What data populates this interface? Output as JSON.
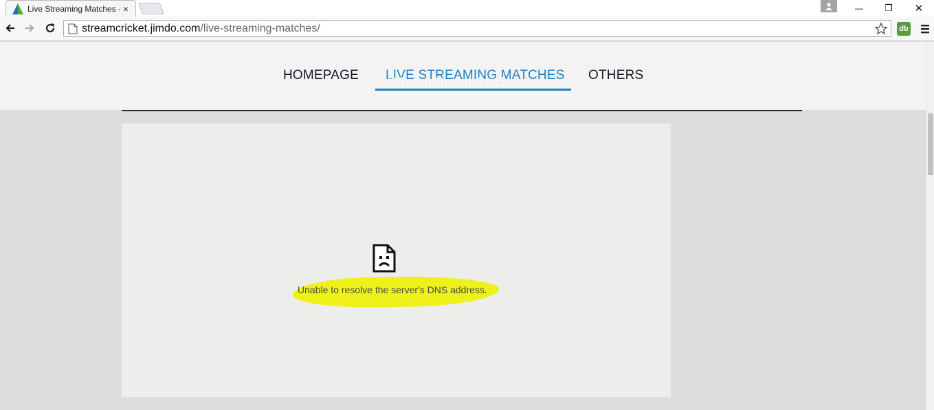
{
  "tab": {
    "title": "Live Streaming Matches -",
    "close_glyph": "×"
  },
  "window": {
    "minimize_glyph": "—",
    "restore_glyph": "❐",
    "close_glyph": "✕"
  },
  "toolbar": {
    "url_host": "streamcricket.jimdo.com",
    "url_path": "/live-streaming-matches/",
    "extension_label": "db"
  },
  "site": {
    "nav": [
      {
        "label": "HOMEPAGE",
        "active": false
      },
      {
        "label": "LIVE STREAMING MATCHES",
        "active": true
      },
      {
        "label": "OTHERS",
        "active": false
      }
    ],
    "watermark": "@TeamStreamCricket"
  },
  "error": {
    "message": "Unable to resolve the server's DNS address."
  },
  "colors": {
    "accent": "#1f7fc4",
    "highlight": "#eef21a"
  }
}
